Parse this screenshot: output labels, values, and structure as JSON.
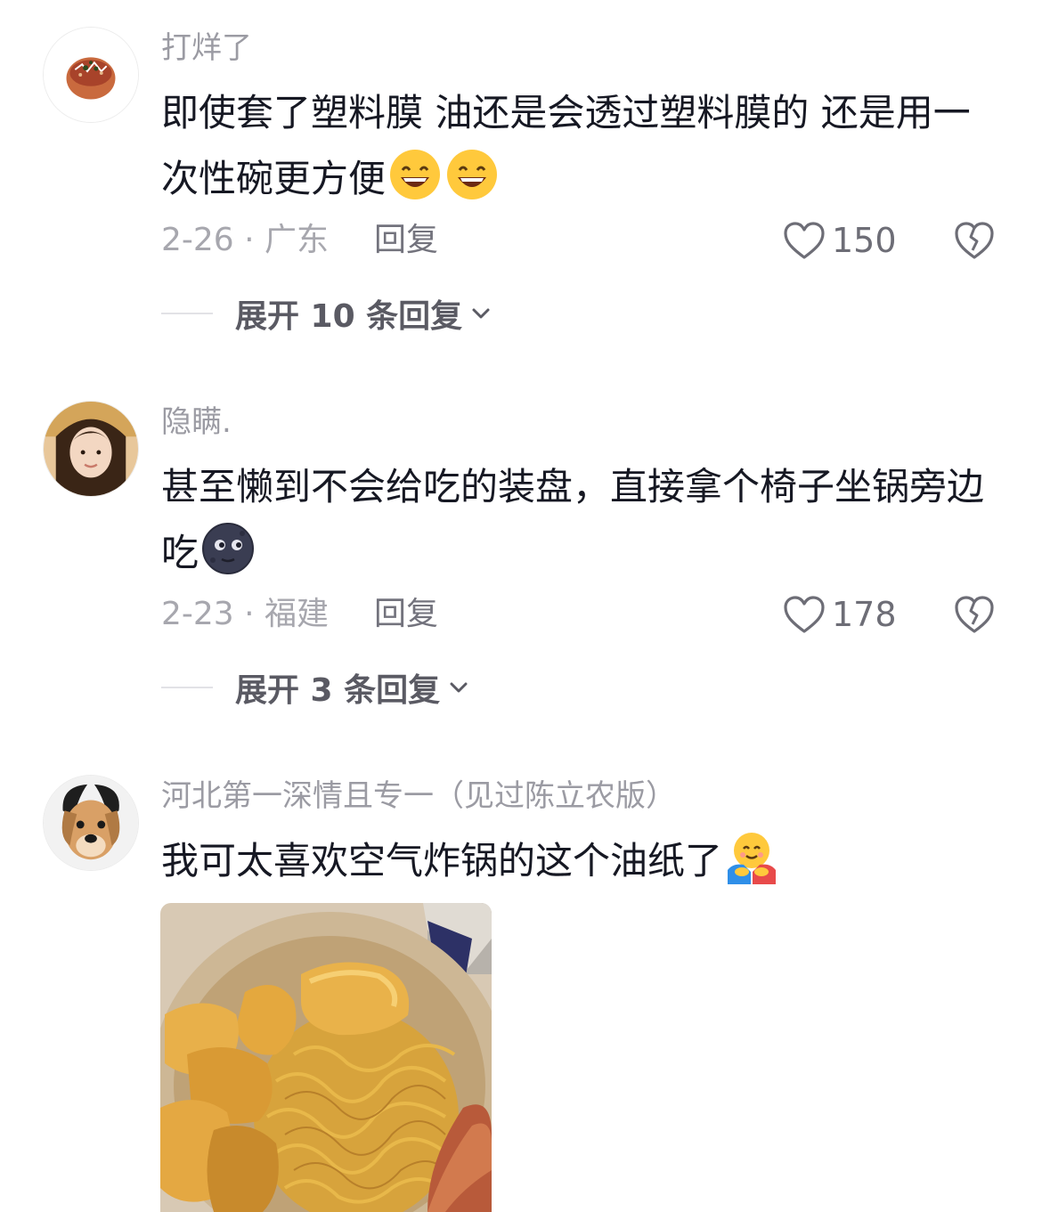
{
  "comments": [
    {
      "username": "打烊了",
      "text": "即使套了塑料膜  油还是会透过塑料膜的  还是用一次性碗更方便",
      "emojis": [
        "grinning-face-emoji",
        "grinning-face-emoji"
      ],
      "date_location": "2-26 · 广东",
      "reply_label": "回复",
      "like_count": "150",
      "expand_label": "展开 10 条回复"
    },
    {
      "username": "隐瞒.",
      "text": "甚至懒到不会给吃的装盘，直接拿个椅子坐锅旁边吃",
      "emojis": [
        "new-moon-face-emoji"
      ],
      "date_location": "2-23 · 福建",
      "reply_label": "回复",
      "like_count": "178",
      "expand_label": "展开 3 条回复"
    },
    {
      "username": "河北第一深情且专一（见过陈立农版）",
      "text": "我可太喜欢空气炸锅的这个油纸了",
      "emojis": [
        "hugging-face-emoji"
      ],
      "image": "air-fryer-food-photo"
    }
  ],
  "colors": {
    "text": "#161823",
    "username": "#9b9ba3",
    "meta": "#a7a7ae",
    "icon": "#6d6d76"
  }
}
